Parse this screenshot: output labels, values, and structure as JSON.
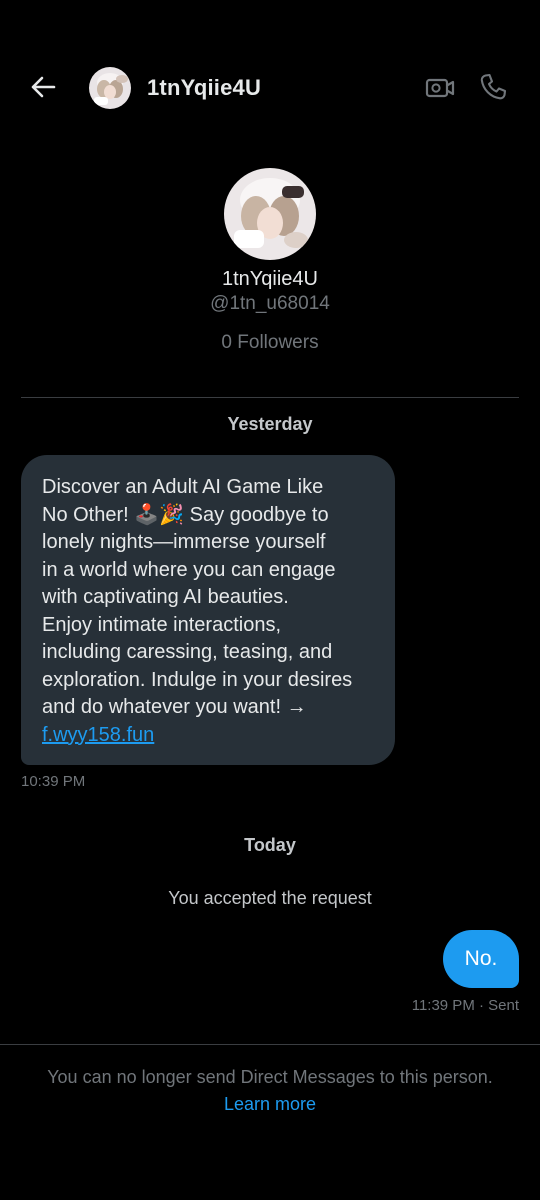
{
  "header": {
    "title": "1tnYqiie4U",
    "back_icon": "arrow-left-icon",
    "video_icon": "video-camera-icon",
    "call_icon": "phone-icon"
  },
  "profile": {
    "name": "1tnYqiie4U",
    "handle": "@1tn_u68014",
    "followers": "0 Followers"
  },
  "conversation": {
    "yesterday_label": "Yesterday",
    "incoming": {
      "text": "Discover an Adult AI Game Like\nNo Other! 🕹️🎉 Say goodbye to\nlonely nights—immerse yourself\nin a world where you can engage\nwith captivating AI beauties.\nEnjoy intimate interactions,\nincluding caressing, teasing, and\nexploration. Indulge in your desires\nand do whatever you want! →\n",
      "link": "f.wyy158.fun",
      "time": "10:39 PM"
    },
    "today_label": "Today",
    "system_message": "You accepted the request",
    "outgoing": {
      "text": "No.",
      "meta": "11:39 PM · Sent"
    }
  },
  "footer": {
    "blocked_text": "You can no longer send Direct Messages to this person.",
    "learn_more": "Learn more"
  },
  "colors": {
    "background": "#000000",
    "incoming_bubble": "#273038",
    "outgoing_bubble": "#1d9bf0",
    "link": "#1d9bf0",
    "muted_text": "#71767b"
  }
}
